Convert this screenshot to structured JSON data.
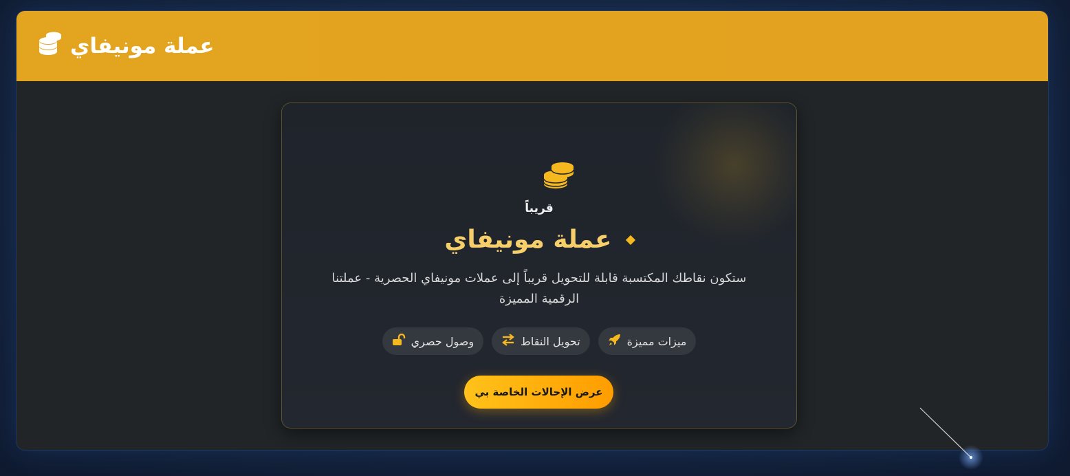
{
  "header": {
    "title": "عملة مونيفاي",
    "icon": "coins-icon"
  },
  "card": {
    "moon_icon": "moon-icon",
    "coins_icon": "coins-icon",
    "soon_label": "قريباً",
    "title": "عملة مونيفاي",
    "description": "ستكون نقاطك المكتسبة قابلة للتحويل قريباً إلى عملات مونيفاي الحصرية - عملتنا الرقمية المميزة",
    "features": [
      {
        "label": "ميزات مميزة",
        "icon": "rocket-icon"
      },
      {
        "label": "تحويل النقاط",
        "icon": "exchange-arrows-icon"
      },
      {
        "label": "وصول حصري",
        "icon": "unlock-icon"
      }
    ],
    "cta_label": "عرض الإحالات الخاصة بي"
  },
  "colors": {
    "accent": "#e3a41f",
    "gold_text": "#f7cf6a",
    "panel_bg": "#212528",
    "page_bg": "#14213a"
  }
}
